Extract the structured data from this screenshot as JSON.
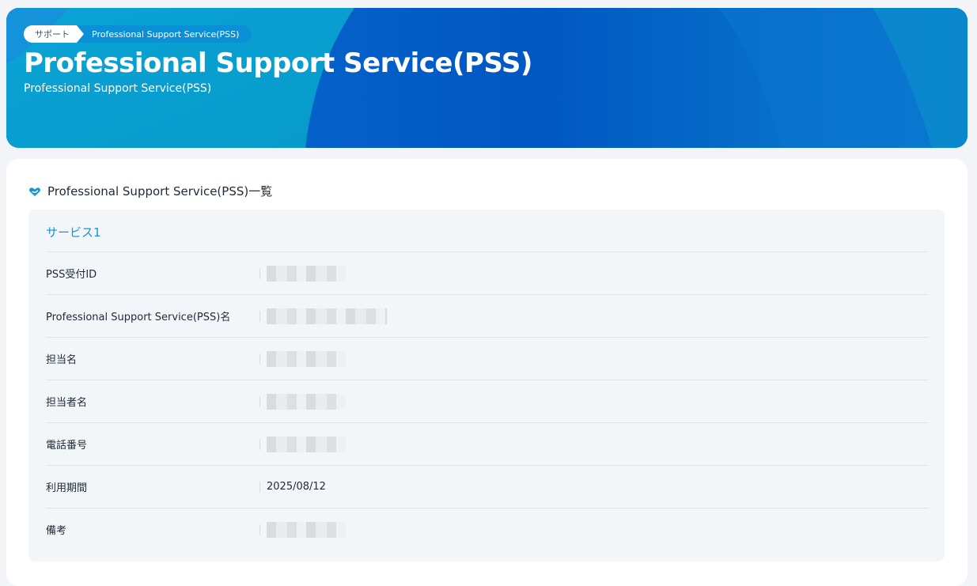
{
  "breadcrumb": {
    "home_label": "サポート",
    "current_label": "Professional Support Service(PSS)"
  },
  "hero": {
    "title": "Professional Support Service(PSS)",
    "subtitle": "Professional Support Service(PSS)"
  },
  "section": {
    "icon": "heart-hand-icon",
    "title": "Professional Support Service(PSS)一覧"
  },
  "service": {
    "name": "サービス1",
    "rows": [
      {
        "label": "PSS受付ID",
        "value": null
      },
      {
        "label": "Professional Support Service(PSS)名",
        "value": null
      },
      {
        "label": "担当名",
        "value": null
      },
      {
        "label": "担当者名",
        "value": null
      },
      {
        "label": "電話番号",
        "value": null
      },
      {
        "label": "利用期間",
        "value": "2025/08/12"
      },
      {
        "label": "備考",
        "value": null
      }
    ]
  },
  "colors": {
    "hero_primary": "#0060c8",
    "hero_accent": "#0a9fd0",
    "service_name": "#1a93d1",
    "page_bg": "#f2f4f7"
  }
}
